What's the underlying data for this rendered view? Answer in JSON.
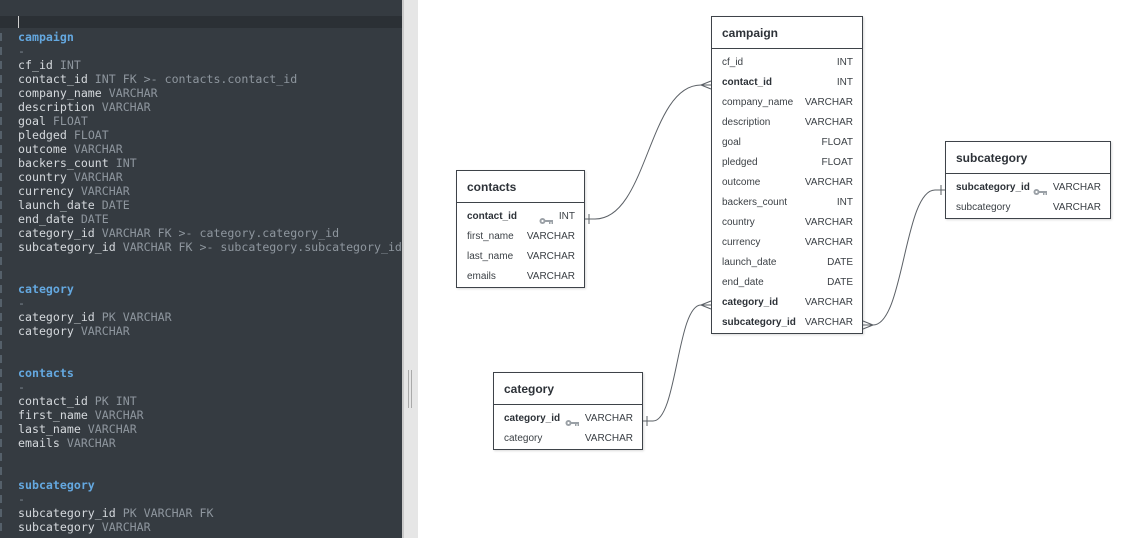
{
  "editor": {
    "lines": [
      [
        {
          "t": "campaign",
          "c": "head"
        }
      ],
      [
        {
          "t": "-",
          "c": "dash"
        }
      ],
      [
        {
          "t": "cf_id",
          "c": "field"
        },
        {
          "t": " INT",
          "c": "type"
        }
      ],
      [
        {
          "t": "contact_id",
          "c": "field"
        },
        {
          "t": " INT FK >- contacts.contact_id",
          "c": "type"
        }
      ],
      [
        {
          "t": "company_name",
          "c": "field"
        },
        {
          "t": " VARCHAR",
          "c": "type"
        }
      ],
      [
        {
          "t": "description",
          "c": "field"
        },
        {
          "t": " VARCHAR",
          "c": "type"
        }
      ],
      [
        {
          "t": "goal",
          "c": "field"
        },
        {
          "t": " FLOAT",
          "c": "type"
        }
      ],
      [
        {
          "t": "pledged",
          "c": "field"
        },
        {
          "t": " FLOAT",
          "c": "type"
        }
      ],
      [
        {
          "t": "outcome",
          "c": "field"
        },
        {
          "t": " VARCHAR",
          "c": "type"
        }
      ],
      [
        {
          "t": "backers_count",
          "c": "field"
        },
        {
          "t": " INT",
          "c": "type"
        }
      ],
      [
        {
          "t": "country",
          "c": "field"
        },
        {
          "t": " VARCHAR",
          "c": "type"
        }
      ],
      [
        {
          "t": "currency",
          "c": "field"
        },
        {
          "t": " VARCHAR",
          "c": "type"
        }
      ],
      [
        {
          "t": "launch_date",
          "c": "field"
        },
        {
          "t": " DATE",
          "c": "type"
        }
      ],
      [
        {
          "t": "end_date",
          "c": "field"
        },
        {
          "t": " DATE",
          "c": "type"
        }
      ],
      [
        {
          "t": "category_id",
          "c": "field"
        },
        {
          "t": " VARCHAR FK >- category.category_id",
          "c": "type"
        }
      ],
      [
        {
          "t": "subcategory_id",
          "c": "field"
        },
        {
          "t": " VARCHAR FK >- subcategory.subcategory_id",
          "c": "type"
        }
      ],
      [],
      [],
      [
        {
          "t": "category",
          "c": "head"
        }
      ],
      [
        {
          "t": "-",
          "c": "dash"
        }
      ],
      [
        {
          "t": "category_id",
          "c": "field"
        },
        {
          "t": " PK VARCHAR",
          "c": "type"
        }
      ],
      [
        {
          "t": "category",
          "c": "field"
        },
        {
          "t": " VARCHAR",
          "c": "type"
        }
      ],
      [],
      [],
      [
        {
          "t": "contacts",
          "c": "head"
        }
      ],
      [
        {
          "t": "-",
          "c": "dash"
        }
      ],
      [
        {
          "t": "contact_id",
          "c": "field"
        },
        {
          "t": " PK INT",
          "c": "type"
        }
      ],
      [
        {
          "t": "first_name",
          "c": "field"
        },
        {
          "t": " VARCHAR",
          "c": "type"
        }
      ],
      [
        {
          "t": "last_name",
          "c": "field"
        },
        {
          "t": " VARCHAR",
          "c": "type"
        }
      ],
      [
        {
          "t": "emails",
          "c": "field"
        },
        {
          "t": " VARCHAR",
          "c": "type"
        }
      ],
      [],
      [],
      [
        {
          "t": "subcategory",
          "c": "head"
        }
      ],
      [
        {
          "t": "-",
          "c": "dash"
        }
      ],
      [
        {
          "t": "subcategory_id",
          "c": "field"
        },
        {
          "t": " PK VARCHAR FK",
          "c": "type"
        }
      ],
      [
        {
          "t": "subcategory",
          "c": "field"
        },
        {
          "t": " VARCHAR",
          "c": "type"
        }
      ]
    ]
  },
  "tables": {
    "campaign": {
      "title": "campaign",
      "fields": [
        {
          "name": "cf_id",
          "type": "INT",
          "key": ""
        },
        {
          "name": "contact_id",
          "type": "INT",
          "key": "fk"
        },
        {
          "name": "company_name",
          "type": "VARCHAR",
          "key": ""
        },
        {
          "name": "description",
          "type": "VARCHAR",
          "key": ""
        },
        {
          "name": "goal",
          "type": "FLOAT",
          "key": ""
        },
        {
          "name": "pledged",
          "type": "FLOAT",
          "key": ""
        },
        {
          "name": "outcome",
          "type": "VARCHAR",
          "key": ""
        },
        {
          "name": "backers_count",
          "type": "INT",
          "key": ""
        },
        {
          "name": "country",
          "type": "VARCHAR",
          "key": ""
        },
        {
          "name": "currency",
          "type": "VARCHAR",
          "key": ""
        },
        {
          "name": "launch_date",
          "type": "DATE",
          "key": ""
        },
        {
          "name": "end_date",
          "type": "DATE",
          "key": ""
        },
        {
          "name": "category_id",
          "type": "VARCHAR",
          "key": "fk"
        },
        {
          "name": "subcategory_id",
          "type": "VARCHAR",
          "key": "fk"
        }
      ]
    },
    "contacts": {
      "title": "contacts",
      "fields": [
        {
          "name": "contact_id",
          "type": "INT",
          "key": "pk"
        },
        {
          "name": "first_name",
          "type": "VARCHAR",
          "key": ""
        },
        {
          "name": "last_name",
          "type": "VARCHAR",
          "key": ""
        },
        {
          "name": "emails",
          "type": "VARCHAR",
          "key": ""
        }
      ]
    },
    "subcategory": {
      "title": "subcategory",
      "fields": [
        {
          "name": "subcategory_id",
          "type": "VARCHAR",
          "key": "pk"
        },
        {
          "name": "subcategory",
          "type": "VARCHAR",
          "key": ""
        }
      ]
    },
    "category": {
      "title": "category",
      "fields": [
        {
          "name": "category_id",
          "type": "VARCHAR",
          "key": "pk"
        },
        {
          "name": "category",
          "type": "VARCHAR",
          "key": ""
        }
      ]
    }
  },
  "relations": [
    {
      "from": "campaign.contact_id",
      "to": "contacts.contact_id",
      "cardinality": "many-to-one"
    },
    {
      "from": "campaign.category_id",
      "to": "category.category_id",
      "cardinality": "many-to-one"
    },
    {
      "from": "campaign.subcategory_id",
      "to": "subcategory.subcategory_id",
      "cardinality": "many-to-one"
    }
  ],
  "colors": {
    "editor_bg": "#353b41",
    "heading": "#64a8e0",
    "field_text": "#d5d9dd",
    "type_text": "#8e969e",
    "table_border": "#3e4349"
  }
}
